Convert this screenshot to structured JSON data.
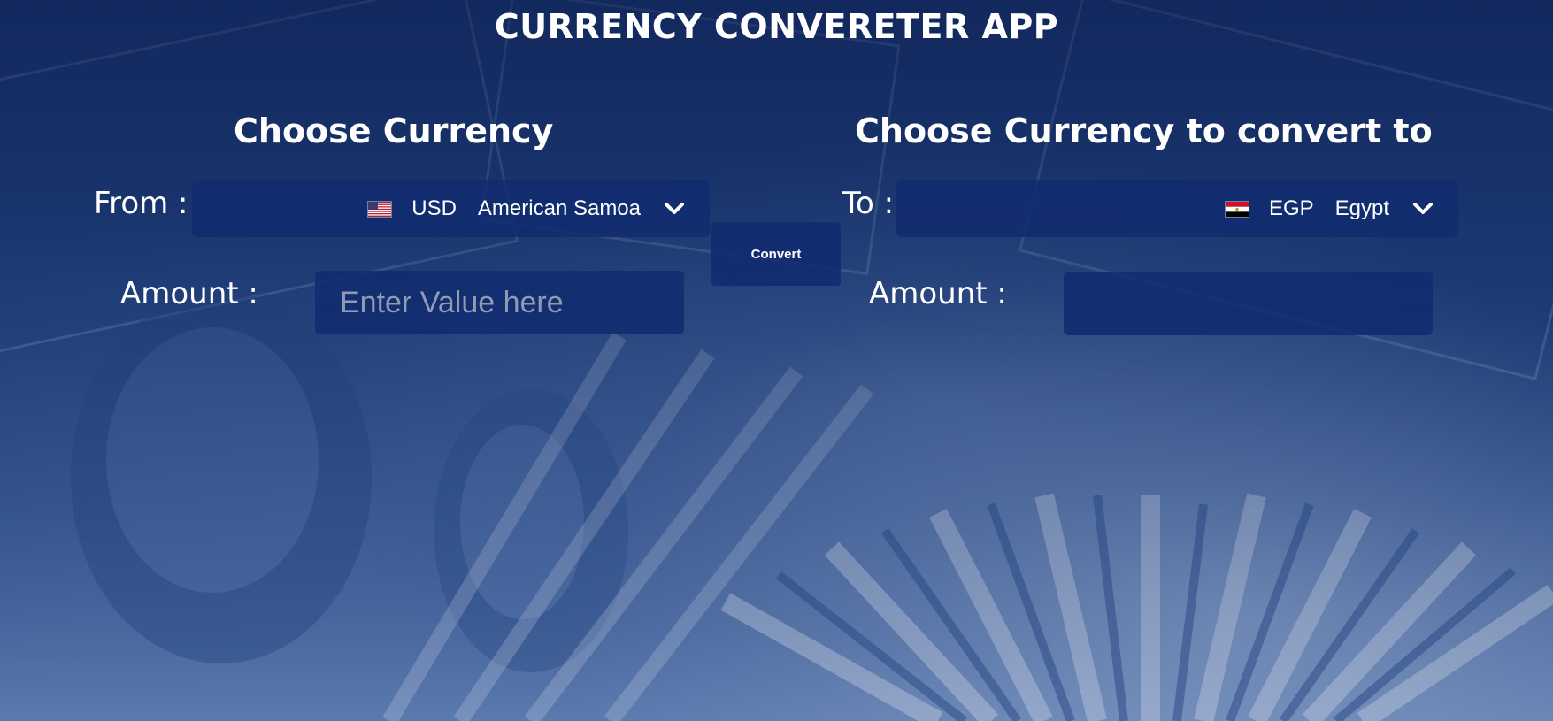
{
  "app": {
    "title": "CURRENCY CONVERETER APP"
  },
  "from_section": {
    "title": "Choose Currency",
    "label": "From :",
    "selected_code": "USD",
    "selected_country": "American Samoa",
    "flag_icon": "us-flag-icon",
    "amount_label": "Amount :",
    "amount_placeholder": "Enter Value here",
    "amount_value": ""
  },
  "to_section": {
    "title": "Choose Currency to convert to",
    "label": "To :",
    "selected_code": "EGP",
    "selected_country": "Egypt",
    "flag_icon": "egypt-flag-icon",
    "amount_label": "Amount :",
    "amount_value": ""
  },
  "convert_button": {
    "label": "Convert"
  },
  "colors": {
    "panel": "#122c70",
    "text": "#ffffff",
    "placeholder": "#8f9bb1"
  }
}
